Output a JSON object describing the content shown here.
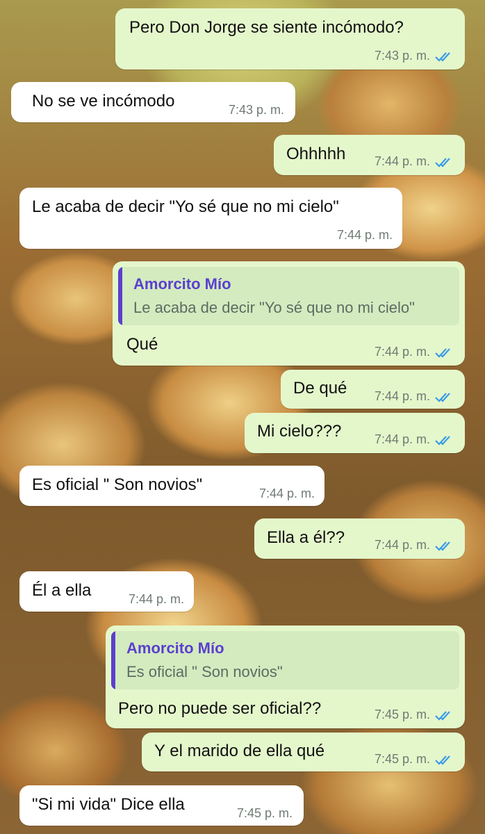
{
  "chat": {
    "messages": [
      {
        "type": "out",
        "text": "Pero Don Jorge se siente incómodo?",
        "time": "7:43 p. m."
      },
      {
        "type": "in",
        "text": "No se ve incómodo",
        "time": "7:43 p. m."
      },
      {
        "type": "out",
        "text": "Ohhhhh",
        "time": "7:44 p. m."
      },
      {
        "type": "in",
        "text": "Le acaba de decir \"Yo sé que no mi cielo\"",
        "time": "7:44 p. m."
      },
      {
        "type": "out",
        "quote_author": "Amorcito Mío",
        "quote_text": "Le acaba de decir \"Yo sé que no mi cielo\"",
        "text": "Qué",
        "time": "7:44 p. m."
      },
      {
        "type": "out",
        "text": "De qué",
        "time": "7:44 p. m."
      },
      {
        "type": "out",
        "text": "Mi cielo???",
        "time": "7:44 p. m."
      },
      {
        "type": "in",
        "text": "Es oficial \" Son novios\"",
        "time": "7:44 p. m."
      },
      {
        "type": "out",
        "text": "Ella a él??",
        "time": "7:44 p. m."
      },
      {
        "type": "in",
        "text": "Él a ella",
        "time": "7:44 p. m."
      },
      {
        "type": "out",
        "quote_author": "Amorcito Mío",
        "quote_text": "Es oficial \" Son novios\"",
        "text": "Pero no puede ser oficial??",
        "time": "7:45 p. m."
      },
      {
        "type": "out",
        "text": "Y el marido de ella qué",
        "time": "7:45 p. m."
      },
      {
        "type": "in",
        "text": "\"Si mi vida\" Dice ella",
        "time": "7:45 p. m."
      }
    ]
  },
  "icons": {
    "read_receipt": "double-check-icon"
  },
  "colors": {
    "outgoing": "#e4f7cb",
    "incoming": "#ffffff",
    "read_ticks": "#3a9be8",
    "quote_author": "#5b3fcf"
  }
}
